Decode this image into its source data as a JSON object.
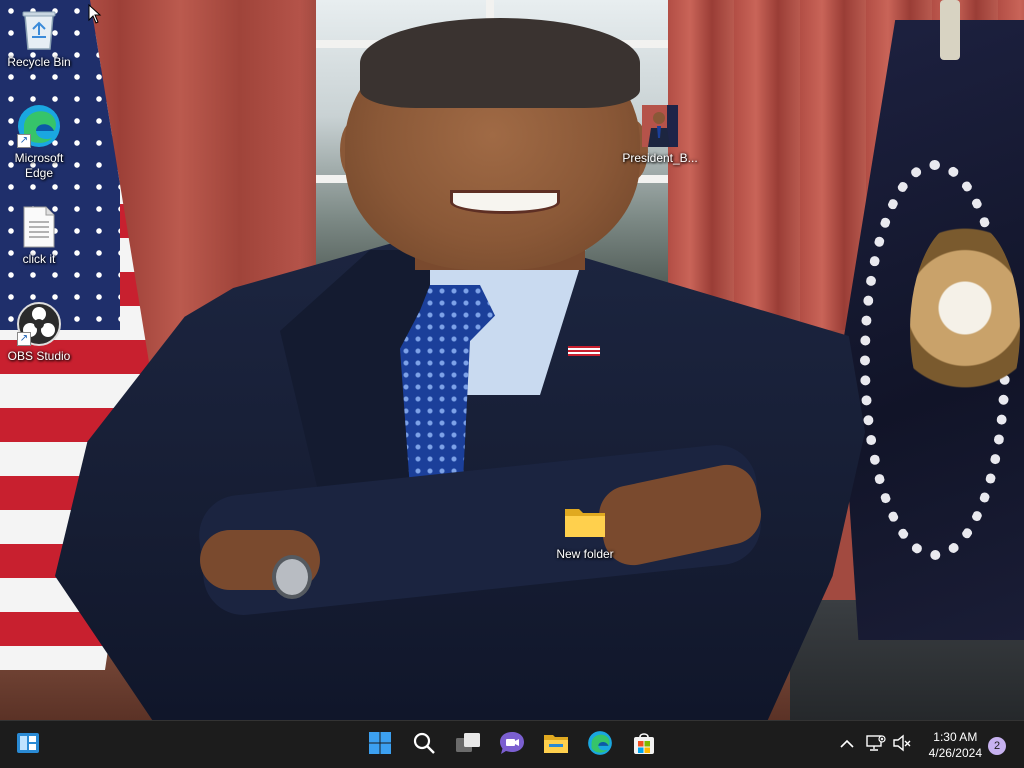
{
  "desktop": {
    "icons": [
      {
        "label": "Recycle Bin",
        "icon": "recycle-bin-icon"
      },
      {
        "label": "Microsoft\nEdge",
        "icon": "edge-icon"
      },
      {
        "label": "click it",
        "icon": "text-file-icon"
      },
      {
        "label": "OBS Studio",
        "icon": "obs-icon"
      },
      {
        "label": "President_B...",
        "icon": "image-file-icon"
      },
      {
        "label": "New folder",
        "icon": "folder-icon"
      }
    ]
  },
  "taskbar": {
    "apps": [
      {
        "name": "Widgets",
        "icon": "widgets-icon"
      },
      {
        "name": "Start",
        "icon": "windows-start-icon"
      },
      {
        "name": "Search",
        "icon": "search-icon"
      },
      {
        "name": "Task View",
        "icon": "task-view-icon"
      },
      {
        "name": "Teams Chat",
        "icon": "chat-icon"
      },
      {
        "name": "File Explorer",
        "icon": "file-explorer-icon"
      },
      {
        "name": "Microsoft Edge",
        "icon": "edge-icon"
      },
      {
        "name": "Microsoft Store",
        "icon": "store-icon"
      }
    ],
    "tray": {
      "time": "1:30 AM",
      "date": "4/26/2024",
      "notification_count": "2"
    }
  },
  "colors": {
    "taskbar_bg": "#1c1c1c",
    "accent": "#0078d4"
  }
}
